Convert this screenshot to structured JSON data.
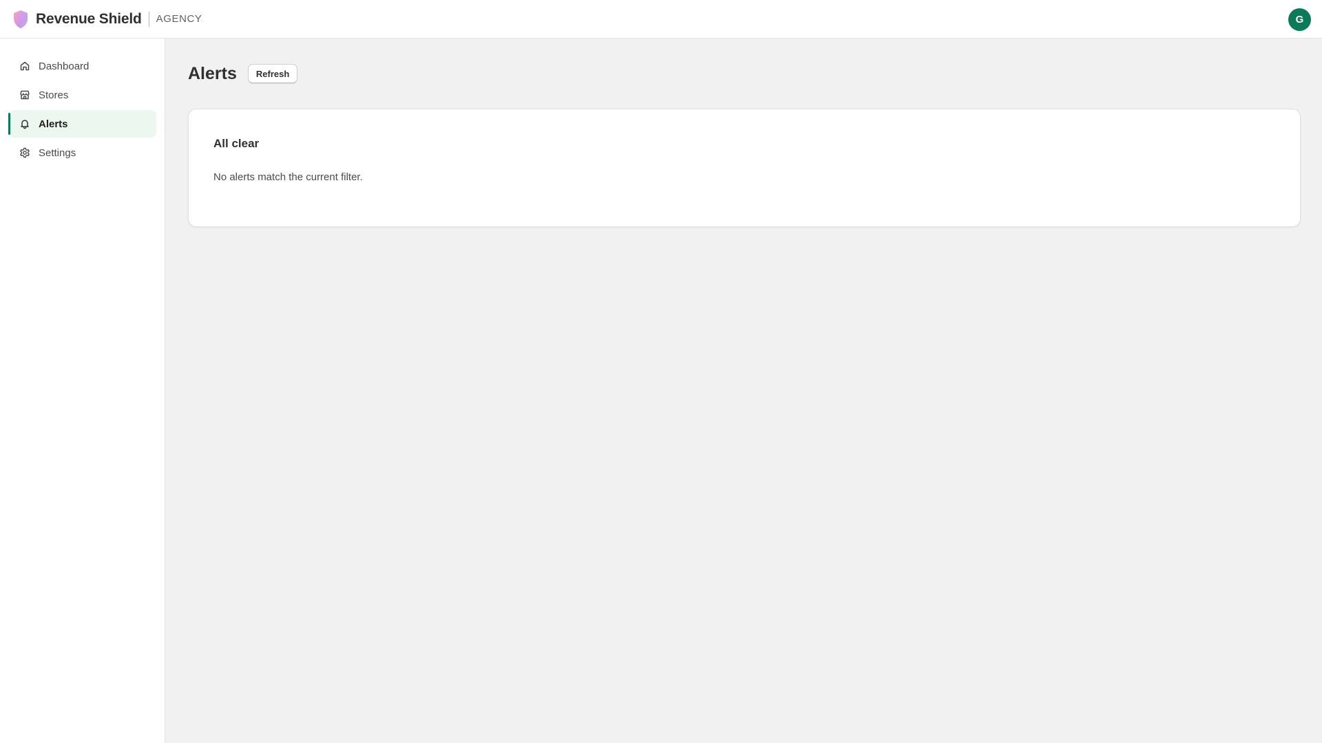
{
  "header": {
    "brand_name": "Revenue Shield",
    "brand_tier": "AGENCY",
    "avatar_initial": "G",
    "avatar_color": "#0b7a5a"
  },
  "sidebar": {
    "items": [
      {
        "label": "Dashboard",
        "icon": "home-icon",
        "active": false
      },
      {
        "label": "Stores",
        "icon": "store-icon",
        "active": false
      },
      {
        "label": "Alerts",
        "icon": "bell-icon",
        "active": true
      },
      {
        "label": "Settings",
        "icon": "gear-icon",
        "active": false
      }
    ]
  },
  "main": {
    "title": "Alerts",
    "refresh_label": "Refresh",
    "card": {
      "title": "All clear",
      "body": "No alerts match the current filter."
    }
  },
  "colors": {
    "accent": "#0b7a5a",
    "active_nav_bg": "#ecf7f0",
    "page_bg": "#f1f1f1"
  }
}
